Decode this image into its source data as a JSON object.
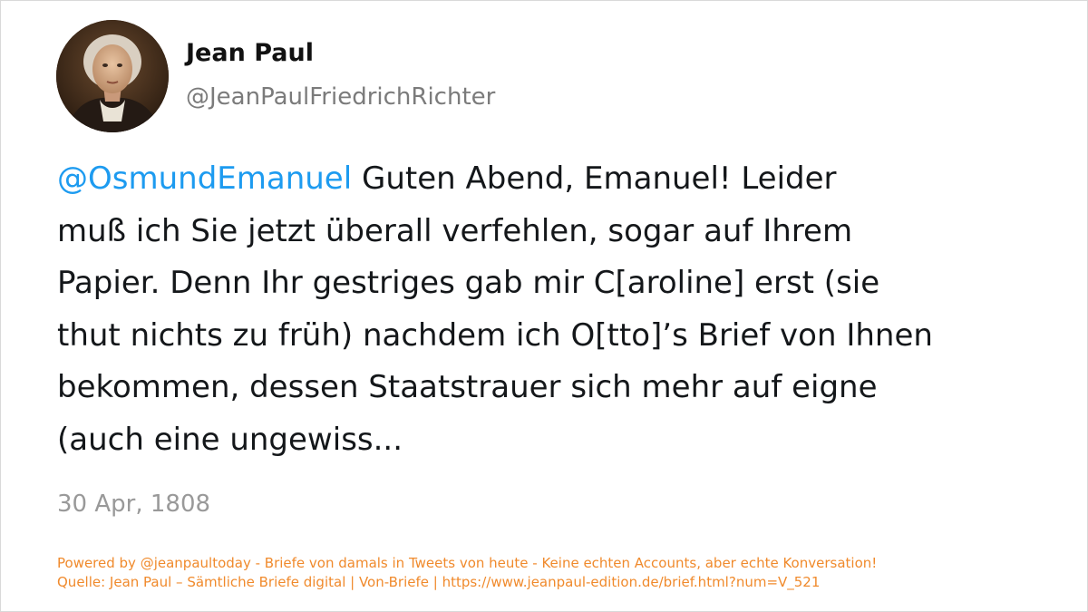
{
  "user": {
    "display_name": "Jean Paul",
    "handle": "@JeanPaulFriedrichRichter",
    "avatar_icon": "portrait-avatar"
  },
  "tweet": {
    "mention": "@OsmundEmanuel",
    "lines": [
      " Guten Abend, Emanuel! Leider",
      "muß ich Sie jetzt überall verfehlen, sogar auf Ihrem",
      "Papier. Denn Ihr gestriges gab mir C[aroline] erst (sie",
      "thut nichts zu früh) nachdem ich O[tto]’s Brief von Ihnen",
      "bekommen, dessen Staatstrauer sich mehr auf eigne",
      "(auch eine ungewiss..."
    ],
    "date": "30 Apr, 1808"
  },
  "footer": {
    "line1": "Powered by @jeanpaultoday - Briefe von damals in Tweets von heute - Keine echten Accounts, aber echte Konversation!",
    "line2": "Quelle: Jean Paul – Sämtliche Briefe digital | Von-Briefe | https://www.jeanpaul-edition.de/brief.html?num=V_521"
  },
  "colors": {
    "mention": "#1d9bf0",
    "text": "#14171a",
    "muted": "#7b7b7b",
    "footer": "#f08a2c"
  }
}
